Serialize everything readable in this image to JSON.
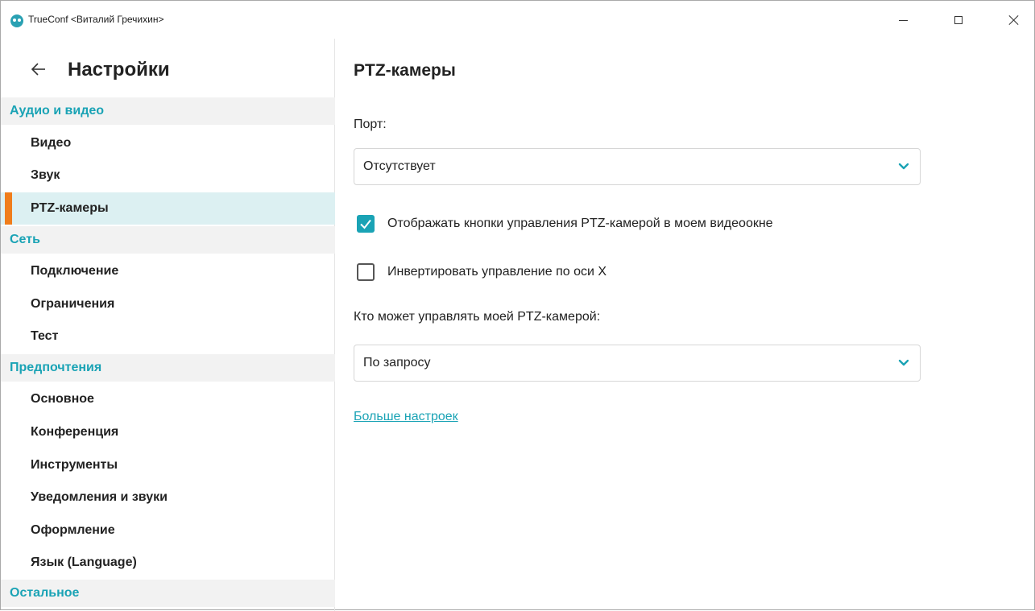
{
  "window": {
    "title": "TrueConf <Виталий Гречихин>",
    "controls": {
      "minimize": "minimize",
      "maximize": "maximize",
      "close": "close"
    }
  },
  "sidebar": {
    "title": "Настройки",
    "back_icon": "arrow-left-icon",
    "sections": [
      {
        "label": "Аудио и видео",
        "items": [
          "Видео",
          "Звук",
          "PTZ-камеры"
        ]
      },
      {
        "label": "Сеть",
        "items": [
          "Подключение",
          "Ограничения",
          "Тест"
        ]
      },
      {
        "label": "Предпочтения",
        "items": [
          "Основное",
          "Конференция",
          "Инструменты",
          "Уведомления и звуки",
          "Оформление",
          "Язык (Language)"
        ]
      },
      {
        "label": "Остальное",
        "items": []
      }
    ],
    "active_item": "PTZ-камеры"
  },
  "main": {
    "title": "PTZ-камеры",
    "port_label": "Порт:",
    "port_value": "Отсутствует",
    "show_controls_label": "Отображать кнопки управления PTZ-камерой в моем видеоокне",
    "show_controls_checked": true,
    "invert_x_label": "Инвертировать управление по оси X",
    "invert_x_checked": false,
    "who_can_control_label": "Кто может управлять моей PTZ-камерой:",
    "who_can_control_value": "По запросу",
    "more_settings_link": "Больше настроек"
  },
  "colors": {
    "accent": "#1aa3b5",
    "active_marker": "#f07d1b",
    "active_item_bg": "#dcf0f2",
    "section_bg": "#f2f2f2"
  }
}
